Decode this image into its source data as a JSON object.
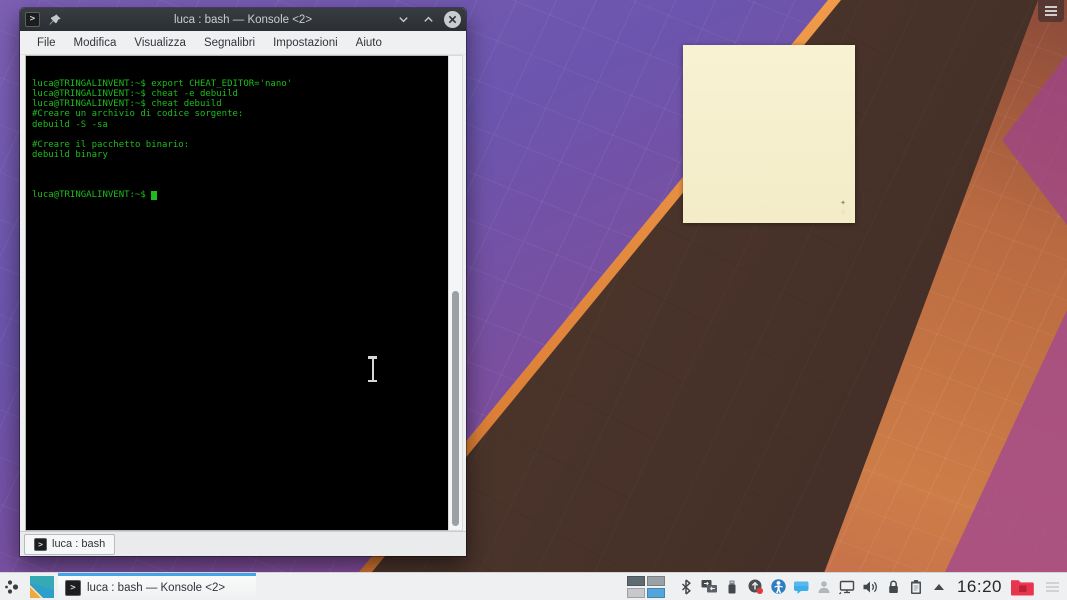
{
  "icons": {
    "konsole_glyph": ">"
  },
  "window": {
    "title": "luca : bash — Konsole <2>",
    "menu_items": [
      "File",
      "Modifica",
      "Visualizza",
      "Segnalibri",
      "Impostazioni",
      "Aiuto"
    ],
    "terminal": {
      "lines": [
        "luca@TRINGALINVENT:~$ export CHEAT_EDITOR='nano'",
        "luca@TRINGALINVENT:~$ cheat -e debuild",
        "luca@TRINGALINVENT:~$ cheat debuild",
        "#Creare un archivio di codice sorgente:",
        "debuild -S -sa",
        "",
        "#Creare il pacchetto binario:",
        "debuild binary",
        ""
      ],
      "prompt_line": "luca@TRINGALINVENT:~$ ",
      "text_color": "#1CBC1C",
      "background": "#000000"
    },
    "tab_label": "luca : bash"
  },
  "panel": {
    "task_button_label": "luca : bash — Konsole <2>",
    "clock": "16:20",
    "pager": {
      "desktops": 4,
      "active_desktop": 4
    },
    "tray_icon_names": [
      "bluetooth-icon",
      "screen-share-icon",
      "usb-device-icon",
      "updates-icon",
      "info-center-icon",
      "chat-icon",
      "user-icon",
      "display-icon",
      "volume-icon",
      "lock-icon",
      "clipboard-icon",
      "expand-tray-icon"
    ],
    "accent_color": "#3daee9",
    "folder_color": "#e8354f"
  }
}
